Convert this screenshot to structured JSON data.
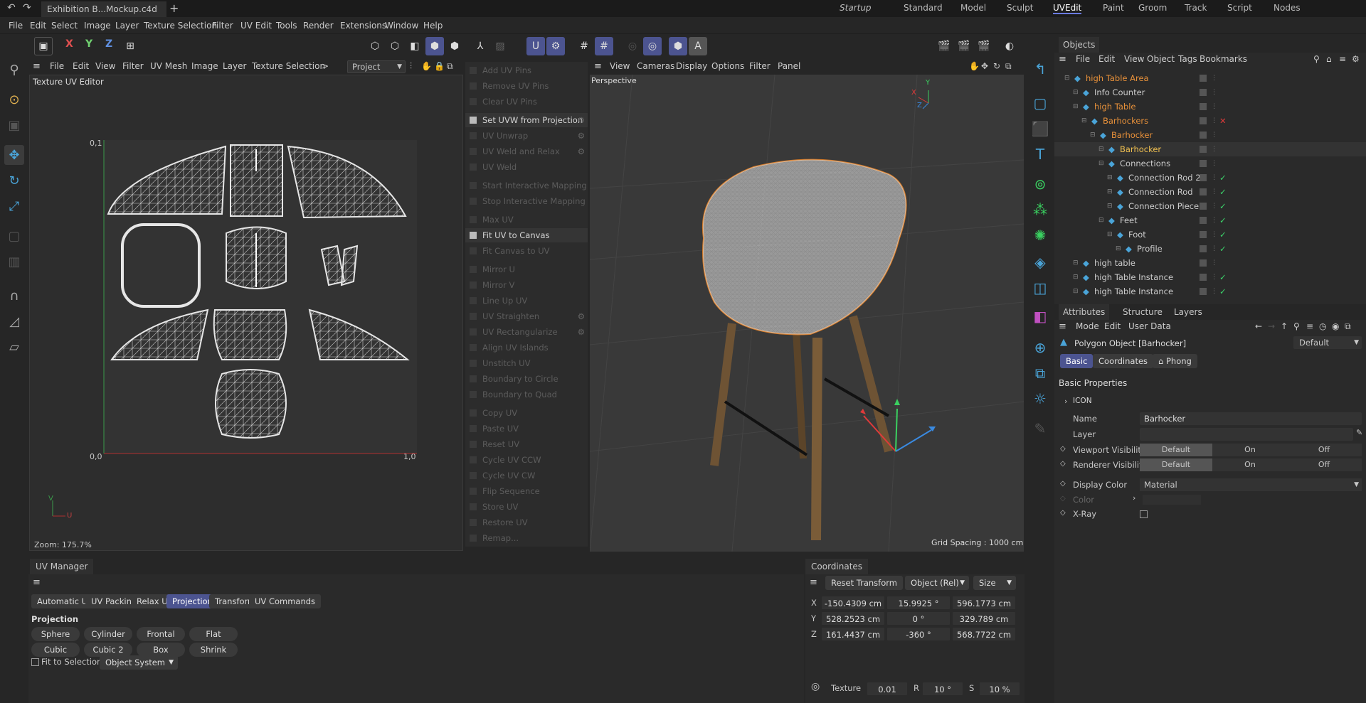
{
  "titlebar": {
    "tab_title": "Exhibition B...Mockup.c4d *",
    "layouts": [
      "Startup",
      "Standard",
      "Model",
      "Sculpt",
      "UVEdit",
      "Paint",
      "Groom",
      "Track",
      "Script",
      "Nodes"
    ],
    "active_layout": "UVEdit"
  },
  "menubar": {
    "items": [
      "File",
      "Edit",
      "Select",
      "Image",
      "Layer",
      "Texture Selection",
      "Filter",
      "UV Edit",
      "Tools",
      "Render",
      "Extensions",
      "Window",
      "Help"
    ]
  },
  "toolbar": {
    "axis_x": "X",
    "axis_y": "Y",
    "axis_z": "Z"
  },
  "uv_editor": {
    "menu": [
      "File",
      "Edit",
      "View",
      "Filter",
      "UV Mesh",
      "Image",
      "Layer",
      "Texture Selection"
    ],
    "more": ">",
    "project_select": "Project",
    "title": "Texture UV Editor",
    "corner_00": "0,0",
    "corner_01": "0,1",
    "corner_10": "1,0",
    "corner_11": "1,1",
    "axis_v": "V",
    "axis_u": "U",
    "zoom": "Zoom: 175.7%"
  },
  "uv_commands": [
    {
      "label": "Add UV Pins",
      "enabled": false,
      "gear": false
    },
    {
      "label": "Remove UV Pins",
      "enabled": false,
      "gear": false
    },
    {
      "label": "Clear UV Pins",
      "enabled": false,
      "gear": false
    },
    {
      "label": "Set UVW from Projection",
      "enabled": true,
      "gear": true
    },
    {
      "label": "UV Unwrap",
      "enabled": false,
      "gear": true
    },
    {
      "label": "UV Weld and Relax",
      "enabled": false,
      "gear": true
    },
    {
      "label": "UV Weld",
      "enabled": false,
      "gear": false
    },
    {
      "label": "Start Interactive Mapping",
      "enabled": false,
      "gear": false
    },
    {
      "label": "Stop Interactive Mapping",
      "enabled": false,
      "gear": false
    },
    {
      "label": "Max UV",
      "enabled": false,
      "gear": false
    },
    {
      "label": "Fit UV to Canvas",
      "enabled": true,
      "gear": false
    },
    {
      "label": "Fit Canvas to UV",
      "enabled": false,
      "gear": false
    },
    {
      "label": "Mirror U",
      "enabled": false,
      "gear": false
    },
    {
      "label": "Mirror V",
      "enabled": false,
      "gear": false
    },
    {
      "label": "Line Up UV",
      "enabled": false,
      "gear": false
    },
    {
      "label": "UV Straighten",
      "enabled": false,
      "gear": true
    },
    {
      "label": "UV Rectangularize",
      "enabled": false,
      "gear": true
    },
    {
      "label": "Align UV Islands",
      "enabled": false,
      "gear": false
    },
    {
      "label": "Unstitch UV",
      "enabled": false,
      "gear": false
    },
    {
      "label": "Boundary to Circle",
      "enabled": false,
      "gear": false
    },
    {
      "label": "Boundary to Quad",
      "enabled": false,
      "gear": false
    },
    {
      "label": "Copy UV",
      "enabled": false,
      "gear": false
    },
    {
      "label": "Paste UV",
      "enabled": false,
      "gear": false
    },
    {
      "label": "Reset UV",
      "enabled": false,
      "gear": false
    },
    {
      "label": "Cycle UV CCW",
      "enabled": false,
      "gear": false
    },
    {
      "label": "Cycle UV CW",
      "enabled": false,
      "gear": false
    },
    {
      "label": "Flip Sequence",
      "enabled": false,
      "gear": false
    },
    {
      "label": "Store UV",
      "enabled": false,
      "gear": false
    },
    {
      "label": "Restore UV",
      "enabled": false,
      "gear": false
    },
    {
      "label": "Remap...",
      "enabled": false,
      "gear": false
    }
  ],
  "viewport": {
    "menu": [
      "View",
      "Cameras",
      "Display",
      "Options",
      "Filter",
      "Panel"
    ],
    "label": "Perspective",
    "grid_spacing": "Grid Spacing : 1000 cm",
    "gizmo_x": "X",
    "gizmo_y": "Y",
    "gizmo_z": "Z"
  },
  "objects": {
    "tab": "Objects",
    "menu": [
      "File",
      "Edit",
      "View",
      "Object",
      "Tags",
      "Bookmarks"
    ],
    "rows": [
      {
        "name": "high Table Area",
        "indent": 0,
        "color": "#e8913a",
        "check": ""
      },
      {
        "name": "Info Counter",
        "indent": 1,
        "color": "#cccccc",
        "check": ""
      },
      {
        "name": "high Table",
        "indent": 1,
        "color": "#e8913a",
        "check": ""
      },
      {
        "name": "Barhockers",
        "indent": 2,
        "color": "#e8913a",
        "check": "x"
      },
      {
        "name": "Barhocker",
        "indent": 3,
        "color": "#e8913a",
        "check": ""
      },
      {
        "name": "Barhocker",
        "indent": 4,
        "color": "#f0c050",
        "check": ""
      },
      {
        "name": "Connections",
        "indent": 4,
        "color": "#cccccc",
        "check": ""
      },
      {
        "name": "Connection Rod 2",
        "indent": 5,
        "color": "#cccccc",
        "check": "v"
      },
      {
        "name": "Connection Rod",
        "indent": 5,
        "color": "#cccccc",
        "check": "v"
      },
      {
        "name": "Connection Piece",
        "indent": 5,
        "color": "#cccccc",
        "check": "v"
      },
      {
        "name": "Feet",
        "indent": 4,
        "color": "#cccccc",
        "check": "v"
      },
      {
        "name": "Foot",
        "indent": 5,
        "color": "#cccccc",
        "check": "v"
      },
      {
        "name": "Profile",
        "indent": 6,
        "color": "#cccccc",
        "check": "v"
      },
      {
        "name": "high table",
        "indent": 1,
        "color": "#cccccc",
        "check": ""
      },
      {
        "name": "high Table Instance",
        "indent": 1,
        "color": "#cccccc",
        "check": "v"
      },
      {
        "name": "high Table Instance",
        "indent": 1,
        "color": "#cccccc",
        "check": "v"
      }
    ]
  },
  "attributes": {
    "tabs": [
      "Attributes",
      "Structure",
      "Layers"
    ],
    "menu": [
      "Mode",
      "Edit",
      "User Data"
    ],
    "object_title": "Polygon Object [Barhocker]",
    "preset": "Default",
    "subtabs": [
      "Basic",
      "Coordinates",
      "Phong"
    ],
    "section": "Basic Properties",
    "icon_group": "ICON",
    "name_label": "Name",
    "name_value": "Barhocker",
    "layer_label": "Layer",
    "viewport_visibility": "Viewport Visibility",
    "renderer_visibility": "Renderer Visibility",
    "vis_options": [
      "Default",
      "On",
      "Off"
    ],
    "display_color_label": "Display Color",
    "display_color_value": "Material",
    "color_label": "Color",
    "xray_label": "X-Ray"
  },
  "uv_manager": {
    "title": "UV Manager",
    "tabs": [
      "Automatic UV",
      "UV Packing",
      "Relax UV",
      "Projection",
      "Transform",
      "UV Commands"
    ],
    "active_tab": "Projection",
    "section": "Projection",
    "buttons_row1": [
      "Sphere",
      "Cylinder",
      "Frontal",
      "Flat"
    ],
    "buttons_row2": [
      "Cubic",
      "Cubic 2",
      "Box",
      "Shrink"
    ],
    "fit_to_selection": "Fit to Selection",
    "system_select": "Object System"
  },
  "coordinates": {
    "title": "Coordinates",
    "reset": "Reset Transform",
    "mode": "Object (Rel)",
    "size_mode": "Size",
    "rows": [
      {
        "axis": "X",
        "pos": "-150.4309 cm",
        "rot": "15.9925 °",
        "size": "596.1773 cm"
      },
      {
        "axis": "Y",
        "pos": "528.2523 cm",
        "rot": "0 °",
        "size": "329.789 cm"
      },
      {
        "axis": "Z",
        "pos": "161.4437 cm",
        "rot": "-360 °",
        "size": "568.7722 cm"
      }
    ],
    "texture_label": "Texture",
    "texture_value": "0.01",
    "r_label": "R",
    "r_value": "10 °",
    "s_label": "S",
    "s_value": "10 %"
  },
  "colors": {
    "accent": "#4c5490",
    "orange": "#e8913a",
    "check": "#3bd36a"
  }
}
